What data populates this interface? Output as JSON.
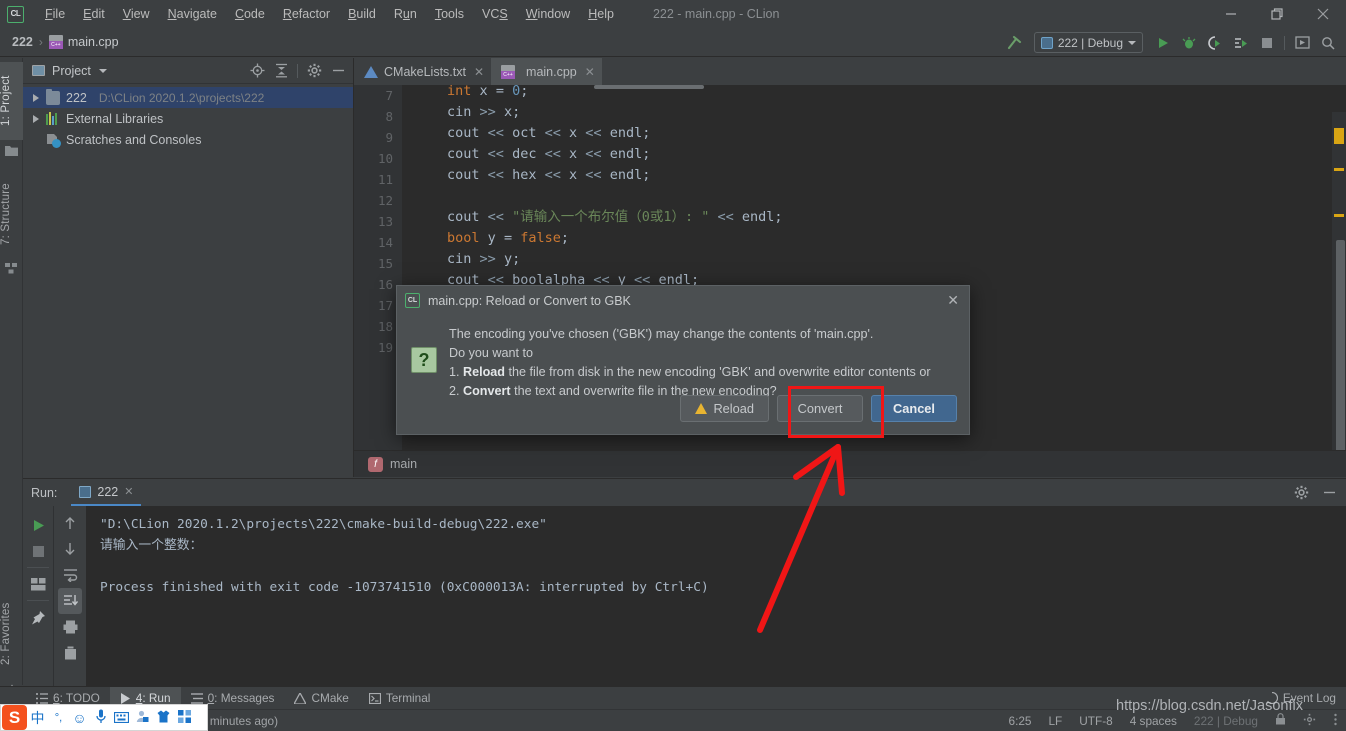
{
  "window": {
    "title": "222 - main.cpp - CLion",
    "logo": "CL",
    "controls": {
      "minimize": "—",
      "maximize": "❐",
      "close": "✕"
    }
  },
  "menubar": {
    "items": [
      "File",
      "Edit",
      "View",
      "Navigate",
      "Code",
      "Refactor",
      "Build",
      "Run",
      "Tools",
      "VCS",
      "Window",
      "Help"
    ]
  },
  "navbar": {
    "project": "222",
    "separator": "›",
    "file": "main.cpp",
    "run_config": "222 | Debug"
  },
  "left_strip": {
    "tabs": [
      "1: Project",
      "7: Structure",
      "2: Favorites"
    ]
  },
  "project_panel": {
    "title": "Project",
    "tools": [
      "locate-icon",
      "collapse-all-icon",
      "gear-icon",
      "hide-icon"
    ],
    "tree": [
      {
        "label": "222",
        "path": "D:\\CLion 2020.1.2\\projects\\222",
        "icon": "folder-icon",
        "selected": true,
        "expandable": true
      },
      {
        "label": "External Libraries",
        "path": "",
        "icon": "library-icon",
        "selected": false,
        "expandable": true
      },
      {
        "label": "Scratches and Consoles",
        "path": "",
        "icon": "scratches-icon",
        "selected": false,
        "expandable": false
      }
    ]
  },
  "editor": {
    "tabs": [
      {
        "label": "CMakeLists.txt",
        "icon": "cmake-icon",
        "active": false
      },
      {
        "label": "main.cpp",
        "icon": "cpp-icon",
        "active": true
      }
    ],
    "first_line_number": 7,
    "lines": [
      {
        "n": 7,
        "text": "int x = 0;"
      },
      {
        "n": 8,
        "text": "cin >> x;"
      },
      {
        "n": 9,
        "text": "cout << oct << x << endl;"
      },
      {
        "n": 10,
        "text": "cout << dec << x << endl;"
      },
      {
        "n": 11,
        "text": "cout << hex << x << endl;"
      },
      {
        "n": 12,
        "text": ""
      },
      {
        "n": 13,
        "text": "cout << \"请输入一个布尔值（0或1）: \" << endl;"
      },
      {
        "n": 14,
        "text": "bool y = false;"
      },
      {
        "n": 15,
        "text": "cin >> y;"
      },
      {
        "n": 16,
        "text": "cout << boolalpha << y << endl;"
      },
      {
        "n": 17,
        "text": ""
      },
      {
        "n": 18,
        "text": ""
      },
      {
        "n": 19,
        "text": ""
      }
    ],
    "breadcrumb": {
      "icon_letter": "f",
      "label": "main"
    }
  },
  "run_panel": {
    "label": "Run:",
    "tab": "222",
    "close": "✕",
    "console": "\"D:\\CLion 2020.1.2\\projects\\222\\cmake-build-debug\\222.exe\"\n请输入一个整数：\n\nProcess finished with exit code -1073741510 (0xC000013A: interrupted by Ctrl+C)"
  },
  "dialog": {
    "logo": "CL",
    "title": "main.cpp: Reload or Convert to GBK",
    "close": "✕",
    "question_icon": "?",
    "line1": "The encoding you've chosen ('GBK') may change the contents of 'main.cpp'.",
    "line2": "Do you want to",
    "line3_num": "1. ",
    "line3_bold": "Reload",
    "line3_rest": " the file from disk in the new encoding 'GBK' and overwrite editor contents or",
    "line4_num": "2. ",
    "line4_bold": "Convert",
    "line4_rest": " the text and overwrite file in the new encoding?",
    "buttons": [
      {
        "label": "Reload",
        "style": "ghost",
        "icon": "warning-icon"
      },
      {
        "label": "Convert",
        "style": "ghost",
        "icon": "",
        "highlighted": true
      },
      {
        "label": "Cancel",
        "style": "primary",
        "icon": ""
      }
    ]
  },
  "bottom_tabs": [
    {
      "num": "6",
      "label": "TODO",
      "icon": "todo-icon",
      "active": false
    },
    {
      "num": "4",
      "label": "Run",
      "icon": "play-icon",
      "active": true
    },
    {
      "num": "0",
      "label": "Messages",
      "icon": "messages-icon",
      "active": false
    },
    {
      "num": "",
      "label": "CMake",
      "icon": "cmake-icon",
      "active": false
    },
    {
      "num": "",
      "label": "Terminal",
      "icon": "terminal-icon",
      "active": false
    }
  ],
  "event_log": "Event Log",
  "statusbar": {
    "left": "0 minutes ago)",
    "caret": "6:25",
    "line_sep": "LF",
    "encoding": "UTF-8",
    "indent": "4 spaces",
    "dim_ghost": "222 | Debug"
  },
  "ime": {
    "logo": "S",
    "icons": [
      "chinese-mode-icon",
      "punctuation-icon",
      "emoji-icon",
      "voice-icon",
      "keyboard-icon",
      "user-icon",
      "skin-icon",
      "apps-icon"
    ]
  },
  "annotation": {
    "watermark": "https://blog.csdn.net/Jasonfix",
    "highlight_color": "#f01616",
    "arrow_color": "#f01616"
  },
  "colors": {
    "window_bg": "#3c3f41",
    "editor_bg": "#2b2b2b",
    "accent_blue": "#41678f",
    "selection": "#2f436a",
    "green": "#4caf6d"
  }
}
